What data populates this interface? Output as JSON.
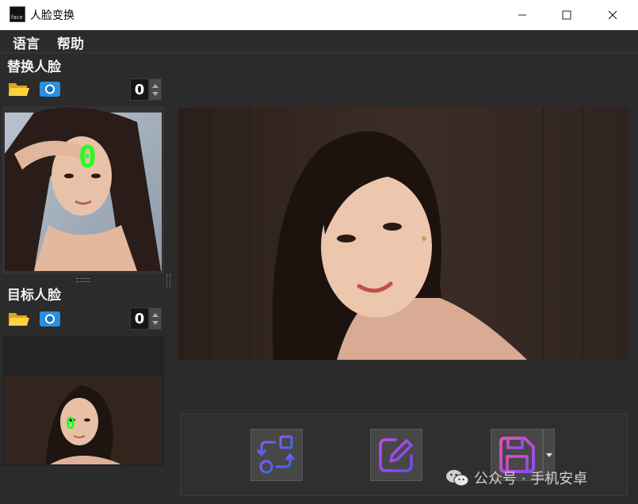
{
  "window": {
    "title": "人脸变换",
    "app_icon_text": "face",
    "minimize_icon": "minimize-icon",
    "maximize_icon": "maximize-icon",
    "close_icon": "close-icon"
  },
  "menu": {
    "items": [
      {
        "label": "语言"
      },
      {
        "label": "帮助"
      }
    ]
  },
  "source_face": {
    "title": "替换人脸",
    "open_icon": "folder-icon",
    "camera_icon": "camera-icon",
    "spin_value": "0",
    "face_index_label": "0"
  },
  "target_face": {
    "title": "目标人脸",
    "open_icon": "folder-icon",
    "camera_icon": "camera-icon",
    "spin_value": "0",
    "face_index_label": "0"
  },
  "actions": {
    "swap_icon": "swap-faces-icon",
    "edit_icon": "edit-icon",
    "save_icon": "save-icon",
    "dropdown_icon": "dropdown-arrow-icon"
  },
  "watermark": {
    "icon": "wechat-icon",
    "text": "公众号 · 手机安卓"
  },
  "colors": {
    "background": "#2b2b2b",
    "marker": "#22ff22",
    "swap_accent": "#3b6cf0",
    "edit_accent": "#a24cf0",
    "save_accent": "#e040c0"
  }
}
